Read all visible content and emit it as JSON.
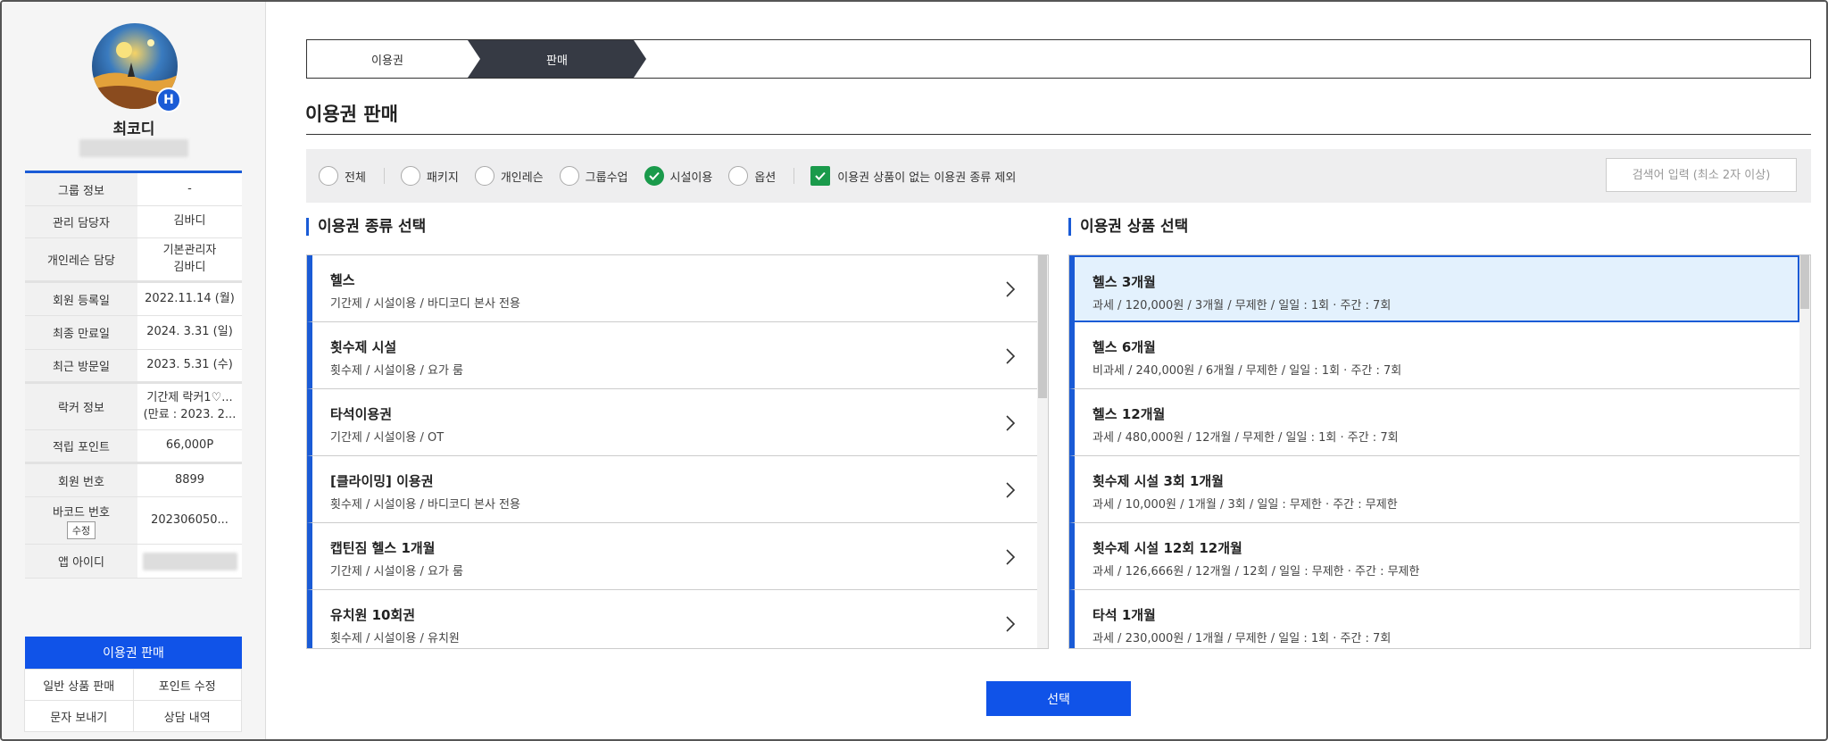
{
  "member": {
    "name": "최코디",
    "badge": "H"
  },
  "info_rows": [
    {
      "key": "그룹 정보",
      "value": "-"
    },
    {
      "key": "관리 담당자",
      "value": "김바디"
    },
    {
      "key": "개인레슨 담당",
      "value": "기본관리자\n김바디"
    },
    {
      "key": "회원 등록일",
      "value": "2022.11.14 (월)"
    },
    {
      "key": "최종 만료일",
      "value": "2024. 3.31 (일)"
    },
    {
      "key": "최근 방문일",
      "value": "2023. 5.31 (수)"
    },
    {
      "key": "락커 정보",
      "value": "기간제 락커1♡...\n(만료 : 2023. 2..."
    },
    {
      "key": "적립 포인트",
      "value": "66,000P"
    },
    {
      "key": "회원 번호",
      "value": "8899"
    },
    {
      "key": "바코드 번호",
      "value": "202306050...",
      "button": "수정"
    },
    {
      "key": "앱 아이디",
      "value": ""
    }
  ],
  "sidebar_actions": {
    "primary": "이용권 판매",
    "grid": [
      "일반 상품 판매",
      "포인트 수정",
      "문자 보내기",
      "상담 내역"
    ]
  },
  "steps": [
    "이용권",
    "판매"
  ],
  "page_title": "이용권 판매",
  "filters": {
    "options": [
      {
        "label": "전체",
        "checked": false
      },
      {
        "label": "패키지",
        "checked": false
      },
      {
        "label": "개인레슨",
        "checked": false
      },
      {
        "label": "그룹수업",
        "checked": false
      },
      {
        "label": "시설이용",
        "checked": true
      },
      {
        "label": "옵션",
        "checked": false
      }
    ],
    "exclude_checkbox": {
      "label": "이용권 상품이 없는 이용권 종류 제외",
      "checked": true
    },
    "search_placeholder": "검색어 입력 (최소 2자 이상)"
  },
  "left_panel": {
    "title": "이용권 종류 선택",
    "items": [
      {
        "name": "헬스",
        "desc": "기간제 / 시설이용 / 바디코디 본사 전용"
      },
      {
        "name": "횟수제 시설",
        "desc": "횟수제 / 시설이용 / 요가 룸"
      },
      {
        "name": "타석이용권",
        "desc": "기간제 / 시설이용 / OT"
      },
      {
        "name": "[클라이밍] 이용권",
        "desc": "횟수제 / 시설이용 / 바디코디 본사 전용"
      },
      {
        "name": "캡틴짐 헬스 1개월",
        "desc": "기간제 / 시설이용 / 요가 룸"
      },
      {
        "name": "유치원 10회권",
        "desc": "횟수제 / 시설이용 / 유치원"
      }
    ]
  },
  "right_panel": {
    "title": "이용권 상품 선택",
    "items": [
      {
        "name": "헬스 3개월",
        "desc": "과세 / 120,000원 / 3개월 / 무제한 / 일일 : 1회 · 주간 : 7회",
        "selected": true
      },
      {
        "name": "헬스 6개월",
        "desc": "비과세 / 240,000원 / 6개월 / 무제한 / 일일 : 1회 · 주간 : 7회"
      },
      {
        "name": "헬스 12개월",
        "desc": "과세 / 480,000원 / 12개월 / 무제한 / 일일 : 1회 · 주간 : 7회"
      },
      {
        "name": "횟수제 시설 3회 1개월",
        "desc": "과세 / 10,000원 / 1개월 / 3회 / 일일 : 무제한 · 주간 : 무제한"
      },
      {
        "name": "횟수제 시설 12회 12개월",
        "desc": "과세 / 126,666원 / 12개월 / 12회 / 일일 : 무제한 · 주간 : 무제한"
      },
      {
        "name": "타석 1개월",
        "desc": "과세 / 230,000원 / 1개월 / 무제한 / 일일 : 1회 · 주간 : 7회"
      }
    ]
  },
  "select_button": "선택",
  "colors": {
    "accent": "#1053e8",
    "check": "#1a9a4b",
    "selected_bg": "#e3f1fd"
  }
}
